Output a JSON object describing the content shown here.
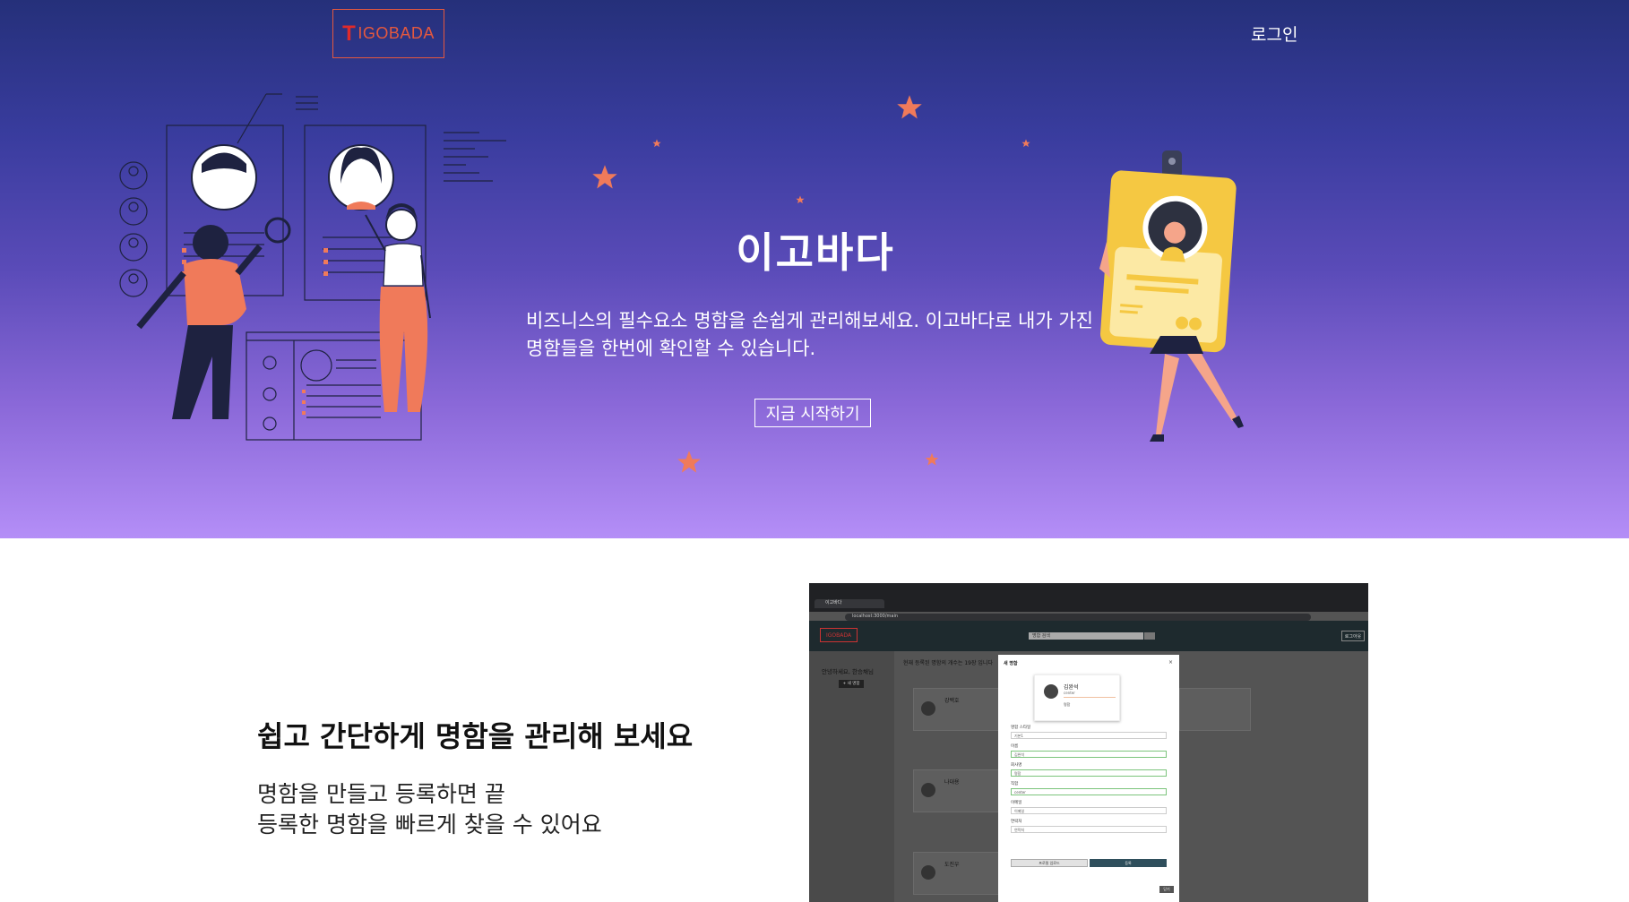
{
  "header": {
    "logo_letter": "T",
    "logo_text": "IGOBADA",
    "login_label": "로그인"
  },
  "hero": {
    "title": "이고바다",
    "description": "비즈니스의 필수요소 명함을 손쉽게 관리해보세요. 이고바다로 내가 가진 명함들을 한번에 확인할 수 있습니다.",
    "cta_label": "지금 시작하기"
  },
  "feature": {
    "title": "쉽고 간단하게 명함을 관리해 보세요",
    "line1": "명함을 만들고 등록하면 끝",
    "line2": "등록한 명함을 빠르게 찾을 수 있어요"
  },
  "screenshot": {
    "tab_title": "이고바다",
    "url": "localhost:3000/main",
    "logo": "IGOBADA",
    "search_placeholder": "명함 검색",
    "nav_button": "로그아웃",
    "greeting": "안녕하세요, 한승채님",
    "new_card_button": "+ 새 명함",
    "main_title": "현재 등록된 명함의 개수는 19장 입니다",
    "cards": [
      {
        "name": "강백호"
      },
      {
        "name": "나대용"
      },
      {
        "name": "도진우"
      }
    ],
    "modal": {
      "title": "새 명함",
      "close": "×",
      "preview_name": "김완석",
      "preview_role": "center",
      "preview_company": "명함",
      "fields": [
        {
          "label": "명함 스타일",
          "value": "기본1"
        },
        {
          "label": "이름",
          "value": "김완석"
        },
        {
          "label": "회사명",
          "value": "명함"
        },
        {
          "label": "직함",
          "value": "center"
        },
        {
          "label": "이메일",
          "value": "이메일"
        },
        {
          "label": "연락처",
          "value": "연락처"
        }
      ],
      "upload_label": "프로필 업로드",
      "submit_label": "등록",
      "close_label": "닫기"
    }
  },
  "colors": {
    "hero_top": "#25307a",
    "hero_bottom": "#b48ef7",
    "accent": "#f07a5a",
    "logo": "#e4583e"
  }
}
